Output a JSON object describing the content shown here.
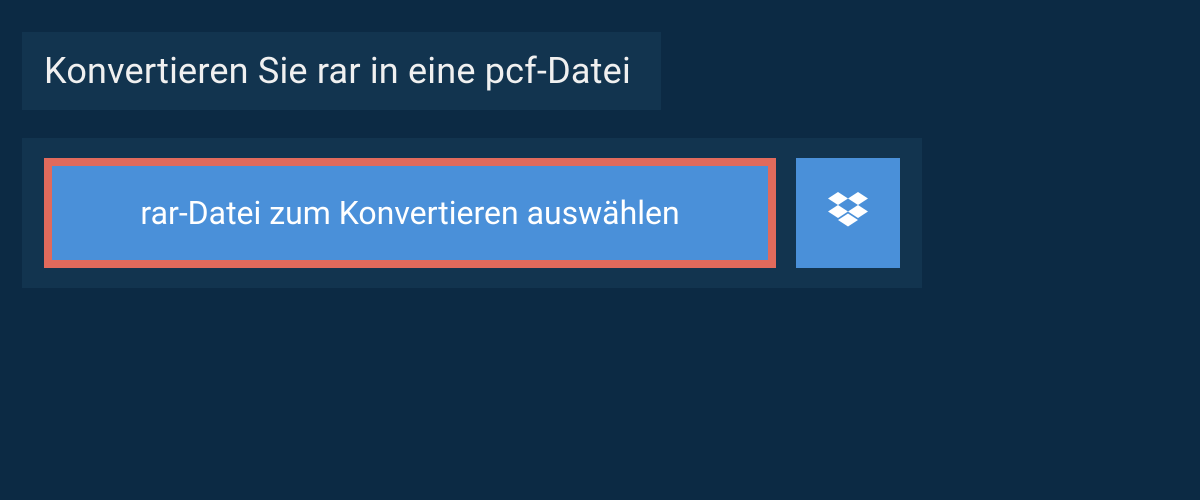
{
  "header": {
    "title": "Konvertieren Sie rar in eine pcf-Datei"
  },
  "upload": {
    "select_label": "rar-Datei zum Konvertieren auswählen",
    "dropbox_icon_name": "dropbox-icon"
  },
  "colors": {
    "page_bg": "#0c2a44",
    "panel_bg": "#12344f",
    "button_bg": "#4a90d9",
    "highlight_border": "#e16a5c",
    "text": "#ffffff"
  }
}
